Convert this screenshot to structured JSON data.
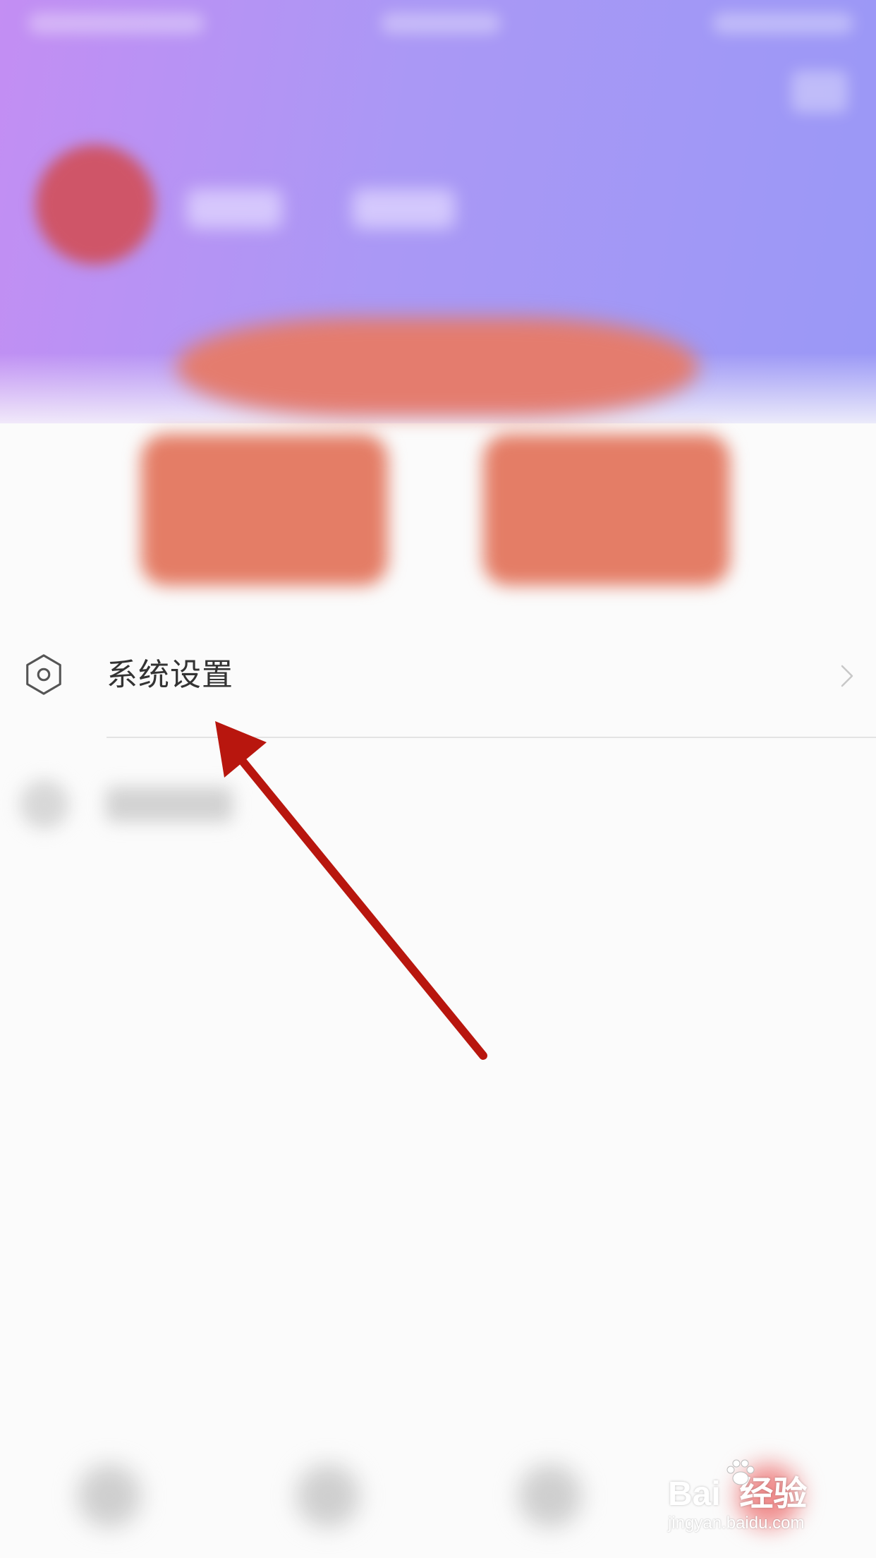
{
  "colors": {
    "header_gradient_start": "#c38ef3",
    "header_gradient_end": "#9a98f6",
    "card_accent": "#e47d66",
    "avatar": "#cf5568",
    "arrow": "#b8160e",
    "text_primary": "#333333",
    "divider": "#e3e3e3"
  },
  "settings_row": {
    "icon": "gear-icon",
    "label": "系统设置",
    "chevron": "chevron-right-icon"
  },
  "watermark": {
    "brand": "Bai  经验",
    "url": "jingyan.baidu.com"
  }
}
